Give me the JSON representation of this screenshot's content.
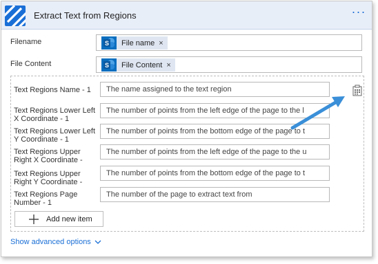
{
  "header": {
    "title": "Extract Text from Regions",
    "more_label": "···"
  },
  "fields": {
    "filename": {
      "label": "Filename",
      "token": "File name",
      "token_remove": "×"
    },
    "file_content": {
      "label": "File Content",
      "token": "File Content",
      "token_remove": "×"
    }
  },
  "regions": {
    "rows": [
      {
        "label": "Text Regions Name - 1",
        "placeholder": "The name assigned to the text region"
      },
      {
        "label": "Text Regions Lower Left X Coordinate - 1",
        "placeholder": "The number of points from the left edge of the page to the l"
      },
      {
        "label": "Text Regions Lower Left Y Coordinate - 1",
        "placeholder": "The number of points from the bottom edge of the page to t"
      },
      {
        "label": "Text Regions Upper Right X Coordinate -",
        "placeholder": "The number of points from the left edge of the page to the u"
      },
      {
        "label": "Text Regions Upper Right Y Coordinate -",
        "placeholder": "The number of points from the bottom edge of the page to t"
      },
      {
        "label": "Text Regions Page Number - 1",
        "placeholder": "The number of the page to extract text from"
      }
    ],
    "add_label": "Add new item"
  },
  "advanced_label": "Show advanced options",
  "colors": {
    "accent": "#1a6fd6",
    "header_bg": "#e8eef8",
    "sharepoint_blue": "#0b6ebf",
    "arrow": "#3a8fd8"
  }
}
